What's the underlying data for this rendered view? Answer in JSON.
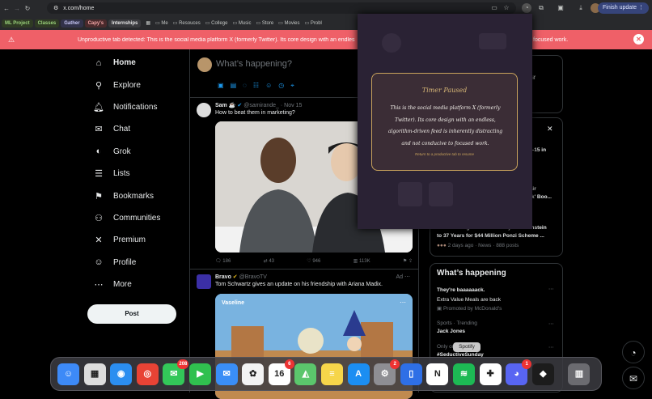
{
  "browser": {
    "url": "x.com/home",
    "finish_update": "Finish update"
  },
  "bookmarks": [
    {
      "label": "ML Project",
      "color": "#9ad27a",
      "bg": "#2f3a24"
    },
    {
      "label": "Classes",
      "color": "#9ad27a",
      "bg": "#2f3a24"
    },
    {
      "label": "Gather",
      "color": "#c7c7f5",
      "bg": "#32324a"
    },
    {
      "label": "Capy's",
      "color": "#f1a4a4",
      "bg": "#4a2a2c"
    },
    {
      "label": "Internships",
      "color": "#e8e8e8",
      "bg": "#3a3a3e"
    }
  ],
  "bookmark_folders": [
    "Me",
    "Resouces",
    "College",
    "Music",
    "Store",
    "Movies",
    "Probl"
  ],
  "banner": {
    "message": "Unproductive tab detected: This is the social media platform X (formerly Twitter). Its core design with an endles",
    "message_tail": "focused work."
  },
  "nav": {
    "items": [
      {
        "label": "Home",
        "icon": "⌂",
        "icon_name": "home-icon"
      },
      {
        "label": "Explore",
        "icon": "⚲",
        "icon_name": "search-icon"
      },
      {
        "label": "Notifications",
        "icon": "🔔︎",
        "icon_name": "bell-icon"
      },
      {
        "label": "Chat",
        "icon": "✉",
        "icon_name": "chat-icon"
      },
      {
        "label": "Grok",
        "icon": "◐",
        "icon_name": "grok-icon"
      },
      {
        "label": "Lists",
        "icon": "☰",
        "icon_name": "lists-icon"
      },
      {
        "label": "Bookmarks",
        "icon": "⚑",
        "icon_name": "bookmark-icon"
      },
      {
        "label": "Communities",
        "icon": "⚇",
        "icon_name": "communities-icon"
      },
      {
        "label": "Premium",
        "icon": "✕",
        "icon_name": "x-logo-icon"
      },
      {
        "label": "Profile",
        "icon": "☺",
        "icon_name": "profile-icon"
      },
      {
        "label": "More",
        "icon": "⋯",
        "icon_name": "more-icon"
      }
    ],
    "post_button": "Post"
  },
  "compose": {
    "placeholder": "What’s happening?"
  },
  "tweets": [
    {
      "name": "Sam",
      "handle": "@samirande_",
      "time": "· Nov 15",
      "text": "How to beat them in marketing?",
      "replies": "186",
      "retweets": "43",
      "likes": "946",
      "views": "113K"
    },
    {
      "name": "Bravo",
      "handle": "@BravoTV",
      "ad": "Ad",
      "text": "Tom Schwartz gives an update on his friendship with Ariana Madix.",
      "video_label": "Vaseline"
    }
  ],
  "right": {
    "frag1": "d if",
    "frag2": "5–15 in",
    "frag3": "lair",
    "frag4": "ok' Boo...",
    "news_title": "Federal Judge Sentences Eliyahu Weinstein",
    "news_title2": "to 37 Years for $44 Million Ponzi Scheme ...",
    "news_meta": "2 days ago · News · 888 posts",
    "whats_happening": "What’s happening",
    "trend1": "They're baaaaaack.",
    "trend1_sub": "Extra Value Meals are back",
    "trend1_promo": "Promoted by McDonald's",
    "trend2_cat": "Sports · Trending",
    "trend2": "Jack Jones",
    "trend3_cat": "Only on",
    "trend3": "#SeductiveSunday"
  },
  "timer_popup": {
    "title": "Timer Paused",
    "body": "This is the social media platform X (formerly Twitter). Its core design with an endless, algorithm-driven feed is inherently distracting and not conducive to focused work.",
    "sub": "Return to a productive tab to resume"
  },
  "dock": {
    "tooltip": "Spotify",
    "apps": [
      {
        "name": "finder-icon",
        "glyph": "☺",
        "bg": "#3d8af7"
      },
      {
        "name": "launchpad-icon",
        "glyph": "▦",
        "bg": "#ddd"
      },
      {
        "name": "safari-icon",
        "glyph": "◉",
        "bg": "#2b8ef0"
      },
      {
        "name": "chrome-icon",
        "glyph": "◎",
        "bg": "#e84335"
      },
      {
        "name": "messages-icon",
        "glyph": "✉",
        "bg": "#33c759",
        "badge": "208"
      },
      {
        "name": "facetime-icon",
        "glyph": "▶",
        "bg": "#30c04f"
      },
      {
        "name": "mail-icon",
        "glyph": "✉",
        "bg": "#3a8ef6"
      },
      {
        "name": "photos-icon",
        "glyph": "✿",
        "bg": "#f3f3f3"
      },
      {
        "name": "calendar-icon",
        "glyph": "16",
        "bg": "#ffffff",
        "badge": "6"
      },
      {
        "name": "maps-icon",
        "glyph": "◭",
        "bg": "#5bc66c"
      },
      {
        "name": "notes-icon",
        "glyph": "≡",
        "bg": "#f6d54a"
      },
      {
        "name": "app-store-icon",
        "glyph": "A",
        "bg": "#1b8ef2"
      },
      {
        "name": "system-settings-icon",
        "glyph": "⚙",
        "bg": "#8e8e93",
        "badge": "2"
      },
      {
        "name": "simulator-icon",
        "glyph": "▯",
        "bg": "#2e6fe6"
      },
      {
        "name": "notion-icon",
        "glyph": "N",
        "bg": "#ffffff"
      },
      {
        "name": "spotify-icon",
        "glyph": "≋",
        "bg": "#1db954"
      },
      {
        "name": "slack-icon",
        "glyph": "✚",
        "bg": "#ffffff"
      },
      {
        "name": "discord-icon",
        "glyph": "◕",
        "bg": "#5865f2",
        "badge": "1"
      },
      {
        "name": "cube-app-icon",
        "glyph": "◆",
        "bg": "#1c1c1c"
      },
      {
        "name": "trash-icon",
        "glyph": "▥",
        "bg": "#6b6b70"
      }
    ]
  }
}
